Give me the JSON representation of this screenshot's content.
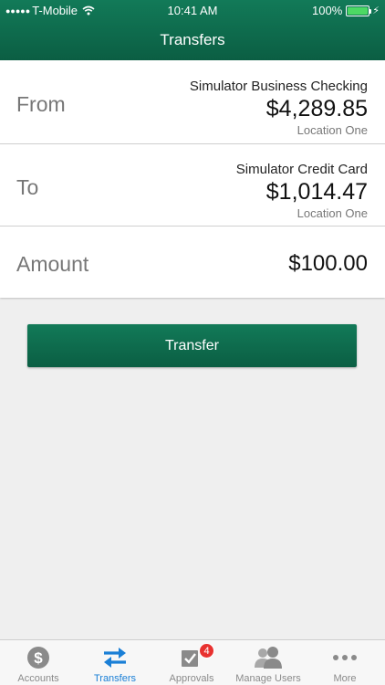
{
  "status_bar": {
    "carrier": "T-Mobile",
    "time": "10:41 AM",
    "battery": "100%"
  },
  "header": {
    "title": "Transfers"
  },
  "from": {
    "label": "From",
    "account_name": "Simulator Business Checking",
    "balance": "$4,289.85",
    "location": "Location One"
  },
  "to": {
    "label": "To",
    "account_name": "Simulator Credit Card",
    "balance": "$1,014.47",
    "location": "Location One"
  },
  "amount": {
    "label": "Amount",
    "value": "$100.00"
  },
  "transfer_button": {
    "label": "Transfer"
  },
  "tabbar": {
    "tabs": [
      {
        "label": "Accounts",
        "icon": "dollar-coin-icon"
      },
      {
        "label": "Transfers",
        "icon": "transfer-arrows-icon",
        "active": true
      },
      {
        "label": "Approvals",
        "icon": "checkbox-icon",
        "badge": "4"
      },
      {
        "label": "Manage Users",
        "icon": "users-icon"
      },
      {
        "label": "More",
        "icon": "more-dots-icon"
      }
    ]
  },
  "colors": {
    "brand_green": "#0b5e43",
    "active_blue": "#1a7fd6",
    "badge_red": "#e8312f"
  }
}
